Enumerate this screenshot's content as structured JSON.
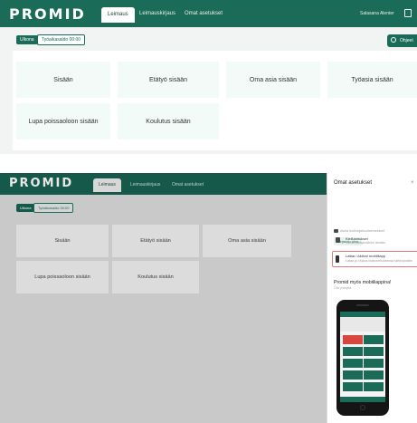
{
  "brand": {
    "logo_text": "PROMID"
  },
  "top_nav": {
    "tabs": [
      {
        "label": "Leimaus"
      },
      {
        "label": "Leimauskirjaus"
      },
      {
        "label": "Omat asetukset"
      }
    ],
    "user_name": "Salasana Alenter"
  },
  "status": {
    "badge_label": "Ulkona",
    "work_time_label": "Työaikasaldo 00:00"
  },
  "guide_button_label": "Ohjeet",
  "actions": {
    "row1": [
      "Sisään",
      "Etätyö sisään",
      "Oma asia sisään",
      "Työasia sisään"
    ],
    "row2": [
      "Lupa poissaoloon sisään",
      "Koulutus sisään"
    ]
  },
  "settings_panel": {
    "title": "Omat asetukset",
    "close_label": "×",
    "device_info": "Aseta kodinsijaisuotaemelukeri",
    "restore_button": "Kirjaudu ulos",
    "item1_title": "Kiellusmukset",
    "item1_sub": "Valitse pääyksikkösi tänään",
    "item2_title": "Lataa / Aktivoi mobiiliapp",
    "item2_sub": "Lataa ja ohjaus lisäsovelluksessa sähköpostiin",
    "promo_title": "Promid myös mobiiliappina!",
    "promo_sub": "Ota yhteyttä"
  },
  "colors": {
    "brand_green": "#1a6b57",
    "tile_bg": "#f2fbf8",
    "highlight_red": "#e37a7a",
    "mobile_red": "#d9463e"
  },
  "icons": [
    "gear-icon",
    "user-icon",
    "device-icon",
    "phone-icon",
    "help-circle-icon"
  ]
}
